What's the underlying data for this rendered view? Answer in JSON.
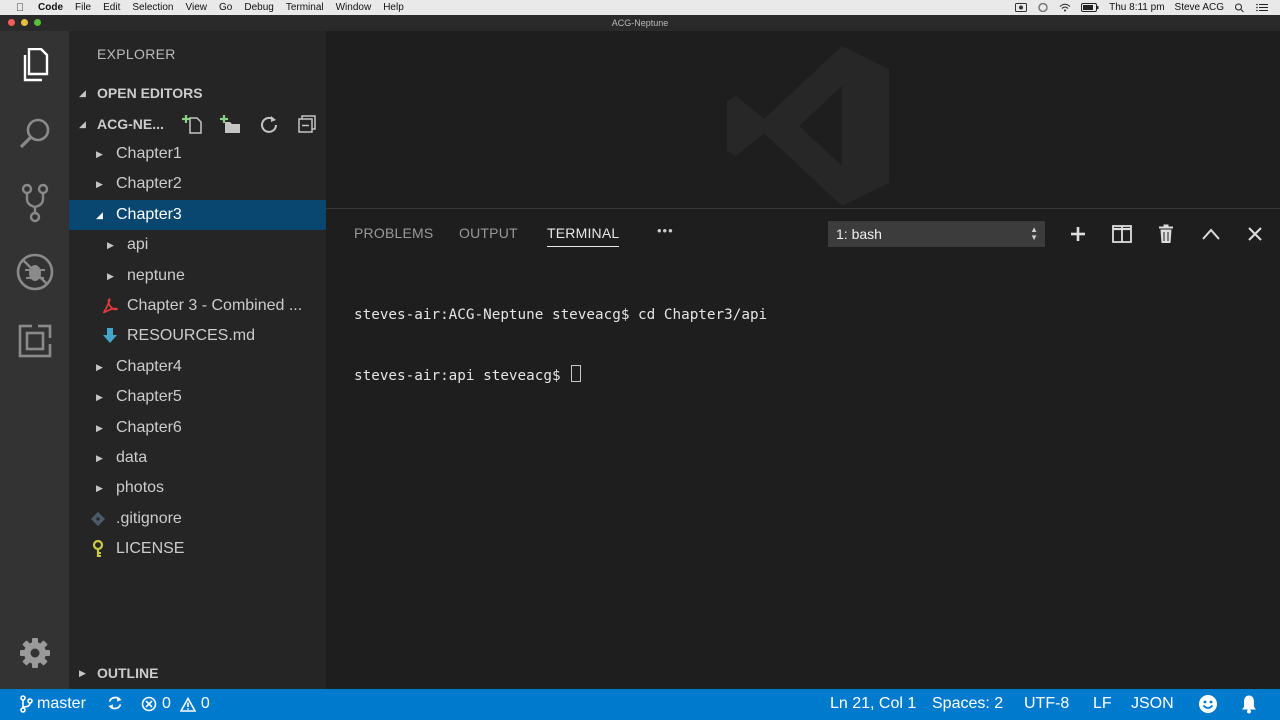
{
  "menubar": {
    "app": "Code",
    "items": [
      "File",
      "Edit",
      "Selection",
      "View",
      "Go",
      "Debug",
      "Terminal",
      "Window",
      "Help"
    ],
    "clock": "Thu 8:11 pm",
    "user": "Steve ACG"
  },
  "window": {
    "title": "ACG-Neptune"
  },
  "activity_bar": {
    "icons": [
      "files-icon",
      "search-icon",
      "source-control-icon",
      "debug-icon",
      "extensions-icon",
      "gear-icon"
    ]
  },
  "sidebar": {
    "title": "EXPLORER",
    "open_editors": "OPEN EDITORS",
    "folder": "ACG-NE...",
    "outline": "OUTLINE",
    "tree": [
      {
        "name": "Chapter1",
        "depth": 0,
        "kind": "folder",
        "expanded": false
      },
      {
        "name": "Chapter2",
        "depth": 0,
        "kind": "folder",
        "expanded": false
      },
      {
        "name": "Chapter3",
        "depth": 0,
        "kind": "folder",
        "expanded": true,
        "selected": true
      },
      {
        "name": "api",
        "depth": 1,
        "kind": "folder",
        "expanded": false
      },
      {
        "name": "neptune",
        "depth": 1,
        "kind": "folder",
        "expanded": false
      },
      {
        "name": "Chapter 3 - Combined ...",
        "depth": 1,
        "kind": "pdf"
      },
      {
        "name": "RESOURCES.md",
        "depth": 1,
        "kind": "md"
      },
      {
        "name": "Chapter4",
        "depth": 0,
        "kind": "folder",
        "expanded": false
      },
      {
        "name": "Chapter5",
        "depth": 0,
        "kind": "folder",
        "expanded": false
      },
      {
        "name": "Chapter6",
        "depth": 0,
        "kind": "folder",
        "expanded": false
      },
      {
        "name": "data",
        "depth": 0,
        "kind": "folder",
        "expanded": false
      },
      {
        "name": "photos",
        "depth": 0,
        "kind": "folder",
        "expanded": false
      },
      {
        "name": ".gitignore",
        "depth": 0,
        "kind": "gitignore"
      },
      {
        "name": "LICENSE",
        "depth": 0,
        "kind": "license"
      }
    ]
  },
  "panel": {
    "tabs": [
      "PROBLEMS",
      "OUTPUT",
      "TERMINAL"
    ],
    "active_tab": "TERMINAL",
    "more": "•••",
    "terminal_select": "1: bash",
    "lines": [
      "steves-air:ACG-Neptune steveacg$ cd Chapter3/api",
      "steves-air:api steveacg$ "
    ]
  },
  "statusbar": {
    "branch": "master",
    "errors": "0",
    "warnings": "0",
    "position": "Ln 21, Col 1",
    "spaces": "Spaces: 2",
    "encoding": "UTF-8",
    "eol": "LF",
    "language": "JSON"
  },
  "colors": {
    "accent": "#007acc",
    "selection": "#094771",
    "activity_bar": "#333333",
    "sidebar": "#252526",
    "editor": "#1e1e1e"
  }
}
